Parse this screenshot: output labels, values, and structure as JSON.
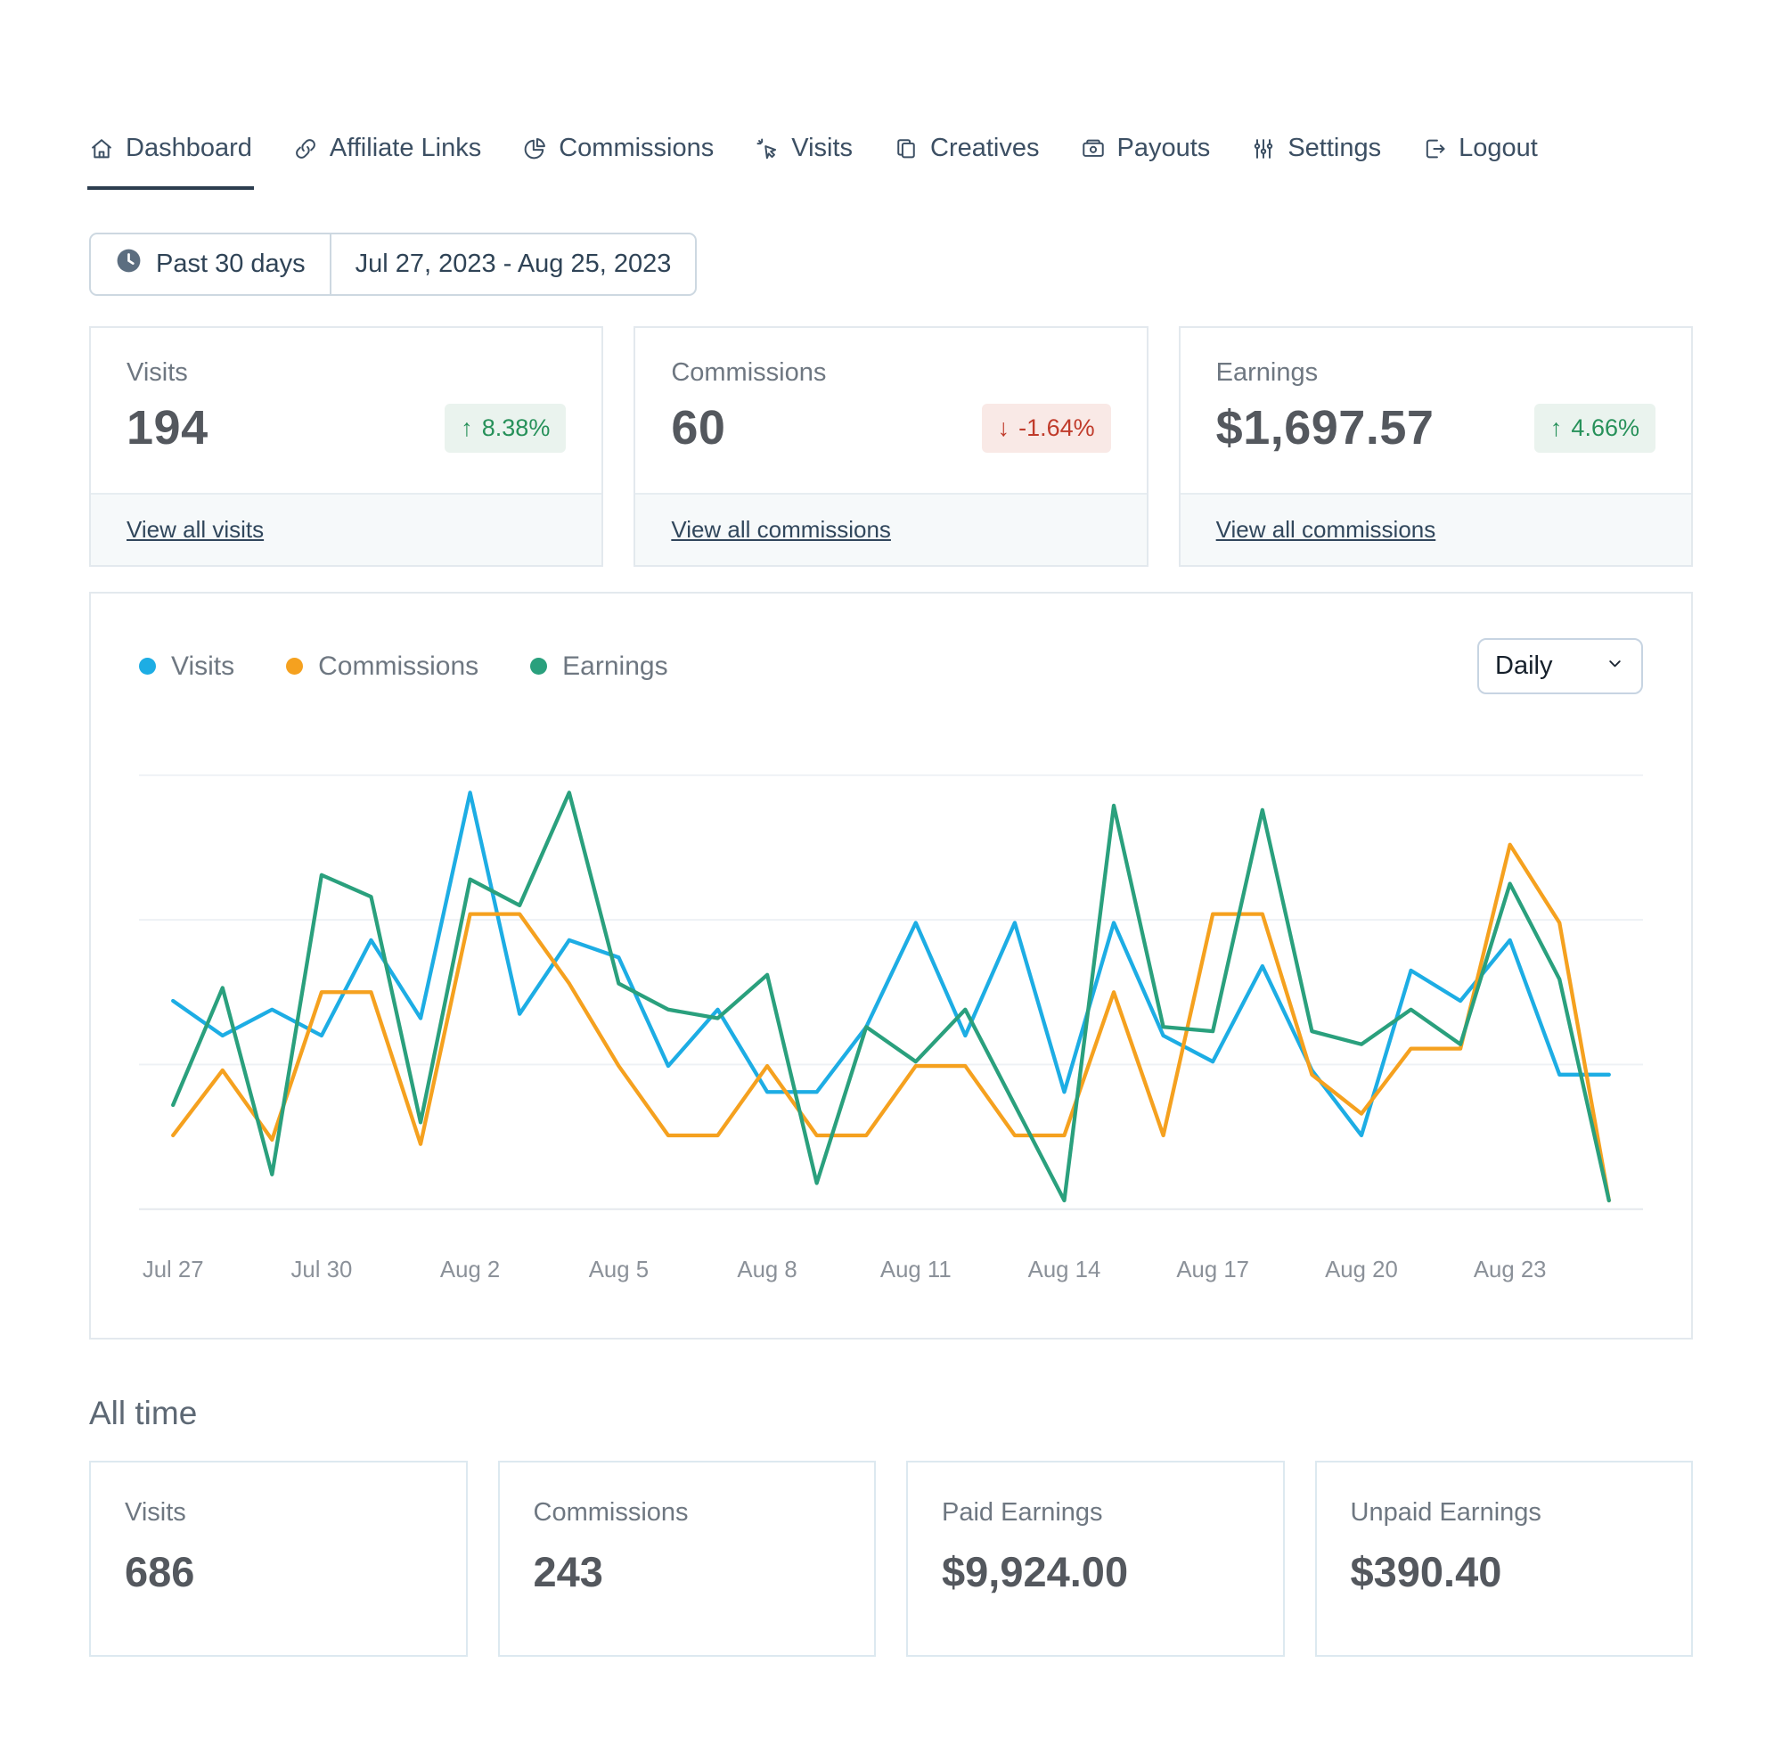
{
  "nav": {
    "items": [
      {
        "label": "Dashboard",
        "icon": "home",
        "active": true
      },
      {
        "label": "Affiliate Links",
        "icon": "link",
        "active": false
      },
      {
        "label": "Commissions",
        "icon": "pie-chart",
        "active": false
      },
      {
        "label": "Visits",
        "icon": "cursor-click",
        "active": false
      },
      {
        "label": "Creatives",
        "icon": "pages",
        "active": false
      },
      {
        "label": "Payouts",
        "icon": "cash",
        "active": false
      },
      {
        "label": "Settings",
        "icon": "sliders",
        "active": false
      },
      {
        "label": "Logout",
        "icon": "logout",
        "active": false
      }
    ]
  },
  "date_filter": {
    "preset_label": "Past 30 days",
    "range_label": "Jul 27, 2023 - Aug 25, 2023"
  },
  "stat_cards": [
    {
      "label": "Visits",
      "value": "194",
      "change": "8.38%",
      "direction": "up",
      "link_label": "View all visits"
    },
    {
      "label": "Commissions",
      "value": "60",
      "change": "-1.64%",
      "direction": "down",
      "link_label": "View all commissions"
    },
    {
      "label": "Earnings",
      "value": "$1,697.57",
      "change": "4.66%",
      "direction": "up",
      "link_label": "View all commissions"
    }
  ],
  "chart": {
    "interval_selected": "Daily"
  },
  "chart_data": {
    "type": "line",
    "x": [
      "Jul 27",
      "Jul 28",
      "Jul 29",
      "Jul 30",
      "Jul 31",
      "Aug 1",
      "Aug 2",
      "Aug 3",
      "Aug 4",
      "Aug 5",
      "Aug 6",
      "Aug 7",
      "Aug 8",
      "Aug 9",
      "Aug 10",
      "Aug 11",
      "Aug 12",
      "Aug 13",
      "Aug 14",
      "Aug 15",
      "Aug 16",
      "Aug 17",
      "Aug 18",
      "Aug 19",
      "Aug 20",
      "Aug 21",
      "Aug 22",
      "Aug 23",
      "Aug 24",
      "Aug 25"
    ],
    "x_tick_labels": [
      "Jul 27",
      "Jul 30",
      "Aug 2",
      "Aug 5",
      "Aug 8",
      "Aug 11",
      "Aug 14",
      "Aug 17",
      "Aug 20",
      "Aug 23"
    ],
    "x_tick_every": 3,
    "ylim": [
      0,
      100
    ],
    "y_axis_labels_visible": false,
    "value_scale_note": "relative height: 0 = x-axis baseline, 100 = top gridline (chart displays no y-axis tick labels)",
    "grid": "horizontal",
    "legend_position": "top-left",
    "legend": [
      "Visits",
      "Commissions",
      "Earnings"
    ],
    "series": [
      {
        "name": "Visits",
        "color": "#1DADE4",
        "values": [
          48,
          40,
          46,
          40,
          62,
          44,
          96,
          45,
          62,
          58,
          33,
          46,
          27,
          27,
          42,
          66,
          40,
          66,
          27,
          66,
          40,
          34,
          56,
          32,
          17,
          55,
          48,
          62,
          31,
          31
        ]
      },
      {
        "name": "Commissions",
        "color": "#F5A11F",
        "values": [
          17,
          32,
          16,
          50,
          50,
          15,
          68,
          68,
          52,
          33,
          17,
          17,
          33,
          17,
          17,
          33,
          33,
          17,
          17,
          50,
          17,
          68,
          68,
          31,
          22,
          37,
          37,
          84,
          66,
          2
        ]
      },
      {
        "name": "Earnings",
        "color": "#2AA07D",
        "values": [
          24,
          51,
          8,
          77,
          72,
          20,
          76,
          70,
          96,
          52,
          46,
          44,
          54,
          6,
          42,
          34,
          46,
          24,
          2,
          93,
          42,
          41,
          92,
          41,
          38,
          46,
          38,
          75,
          53,
          2
        ]
      }
    ]
  },
  "all_time": {
    "title": "All time",
    "cards": [
      {
        "label": "Visits",
        "value": "686"
      },
      {
        "label": "Commissions",
        "value": "243"
      },
      {
        "label": "Paid Earnings",
        "value": "$9,924.00"
      },
      {
        "label": "Unpaid Earnings",
        "value": "$390.40"
      }
    ]
  },
  "colors": {
    "nav_text": "#3C4F63",
    "active_underline": "#2C3D4F",
    "positive": "#27915A",
    "positive_bg": "#EAF3EE",
    "negative": "#C03B2B",
    "negative_bg": "#F9E9E6",
    "visits": "#1DADE4",
    "commissions": "#F5A11F",
    "earnings": "#2AA07D",
    "gridline": "#EEF1F5",
    "axis_line": "#E5E9ED",
    "tick_label": "#8B9199"
  }
}
